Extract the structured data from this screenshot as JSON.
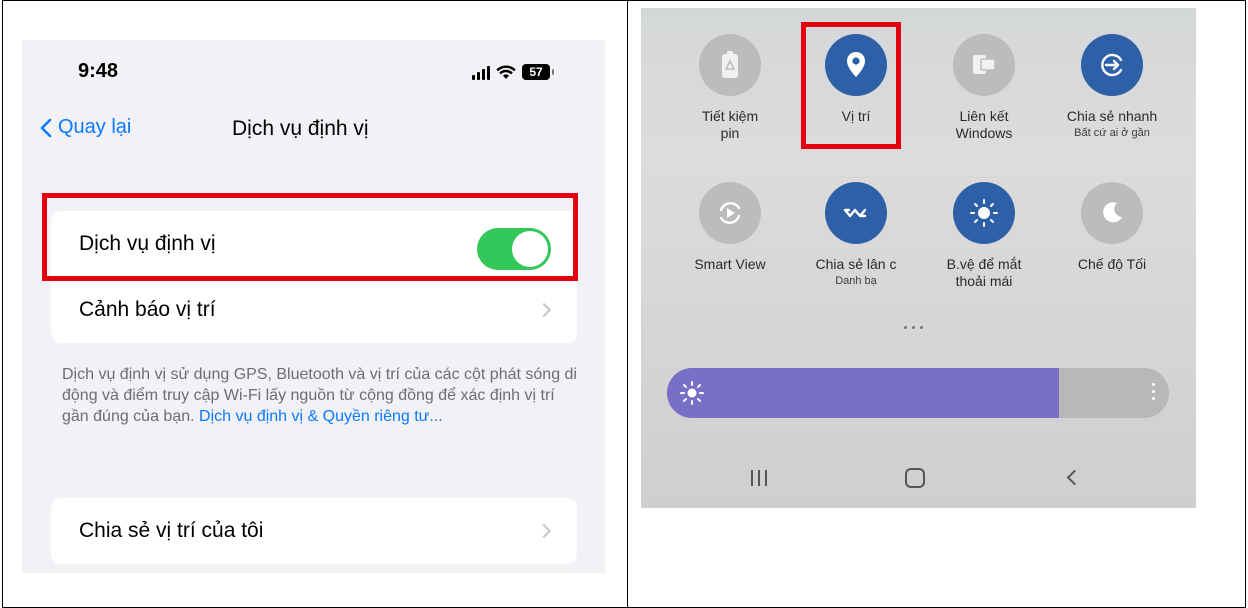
{
  "ios": {
    "status": {
      "time": "9:48",
      "battery": "57"
    },
    "nav": {
      "back_label": "Quay lại",
      "title": "Dịch vụ định vị"
    },
    "rows": {
      "location_services": "Dịch vụ định vị",
      "location_alerts": "Cảnh báo vị trí",
      "share_location": "Chia sẻ vị trí của tôi"
    },
    "location_services_enabled": true,
    "footnote": {
      "text": "Dịch vụ định vị sử dụng GPS, Bluetooth và vị trí của các cột phát sóng di động và điểm truy cập Wi-Fi lấy nguồn từ cộng đồng để xác định vị trí gần đúng của bạn. ",
      "link": "Dịch vụ định vị & Quyền riêng tư..."
    }
  },
  "android": {
    "tiles": [
      {
        "label": "Tiết kiệm pin",
        "sub": "",
        "icon": "battery-saver-icon",
        "active": false
      },
      {
        "label": "Vị trí",
        "sub": "",
        "icon": "location-pin-icon",
        "active": true
      },
      {
        "label": "Liên kết Windows",
        "sub": "",
        "icon": "link-windows-icon",
        "active": false
      },
      {
        "label": "Chia sẻ nhanh",
        "sub": "Bất cứ ai ở gần",
        "icon": "quick-share-icon",
        "active": true
      },
      {
        "label": "Smart View",
        "sub": "",
        "icon": "smart-view-icon",
        "active": false
      },
      {
        "label": "Chia sẻ lân c",
        "sub": "Danh bạ",
        "icon": "nearby-share-icon",
        "active": true
      },
      {
        "label": "B.vệ để mắt thoải mái",
        "sub": "",
        "icon": "eye-comfort-icon",
        "active": true
      },
      {
        "label": "Chế độ Tối",
        "sub": "",
        "icon": "dark-mode-icon",
        "active": false
      }
    ],
    "brightness_level": 0.78
  },
  "colors": {
    "ios_accent": "#0a7aff",
    "ios_toggle_on": "#34c759",
    "android_tile_active": "#2d60a6",
    "android_tile_inactive": "#bcbcbc",
    "brightness_fill": "#7a6fc6",
    "highlight": "#e3000f"
  }
}
